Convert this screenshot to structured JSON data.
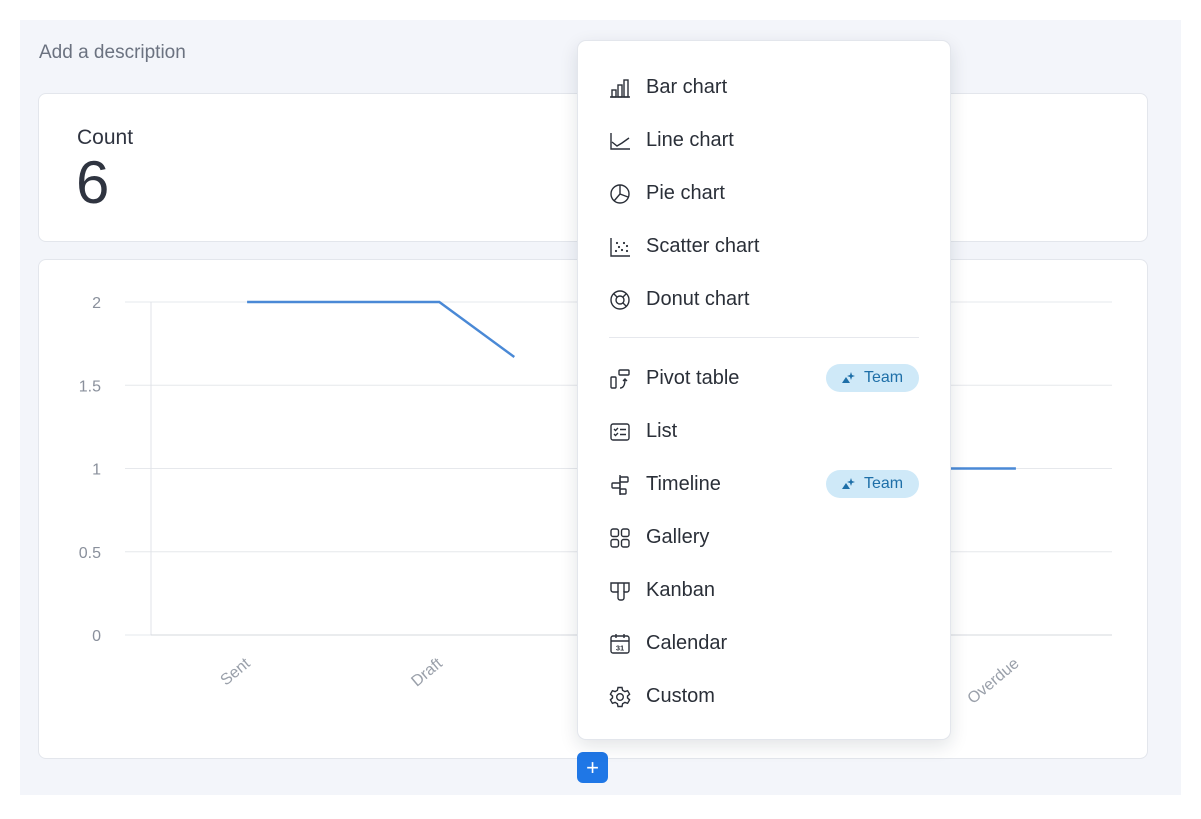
{
  "page": {
    "description_placeholder": "Add a description"
  },
  "count_card": {
    "title": "Count",
    "value": "6"
  },
  "chart_data": {
    "type": "line",
    "categories": [
      "Sent",
      "Draft",
      "",
      "",
      "Overdue"
    ],
    "series": [
      {
        "values": [
          2,
          2,
          null,
          null,
          1
        ]
      }
    ],
    "yticks": [
      "0",
      "0.5",
      "1",
      "1.5",
      "2"
    ],
    "ylim": [
      0,
      2
    ],
    "grid": true,
    "line_color": "#4a89d6"
  },
  "add_button": {
    "label": "+"
  },
  "menu": {
    "items": [
      {
        "label": "Bar chart",
        "icon": "bar-chart-icon"
      },
      {
        "label": "Line chart",
        "icon": "line-chart-icon"
      },
      {
        "label": "Pie chart",
        "icon": "pie-chart-icon"
      },
      {
        "label": "Scatter chart",
        "icon": "scatter-chart-icon"
      },
      {
        "label": "Donut chart",
        "icon": "donut-chart-icon"
      },
      {
        "label": "Pivot table",
        "icon": "pivot-table-icon",
        "badge": "Team"
      },
      {
        "label": "List",
        "icon": "list-icon"
      },
      {
        "label": "Timeline",
        "icon": "timeline-icon",
        "badge": "Team"
      },
      {
        "label": "Gallery",
        "icon": "gallery-icon"
      },
      {
        "label": "Kanban",
        "icon": "kanban-icon"
      },
      {
        "label": "Calendar",
        "icon": "calendar-icon",
        "icon_text": "31"
      },
      {
        "label": "Custom",
        "icon": "gear-icon"
      }
    ]
  },
  "colors": {
    "accent": "#1f77e6",
    "badge_bg": "#cfe9f8",
    "badge_text": "#1e6fa8",
    "line": "#4a89d6"
  }
}
